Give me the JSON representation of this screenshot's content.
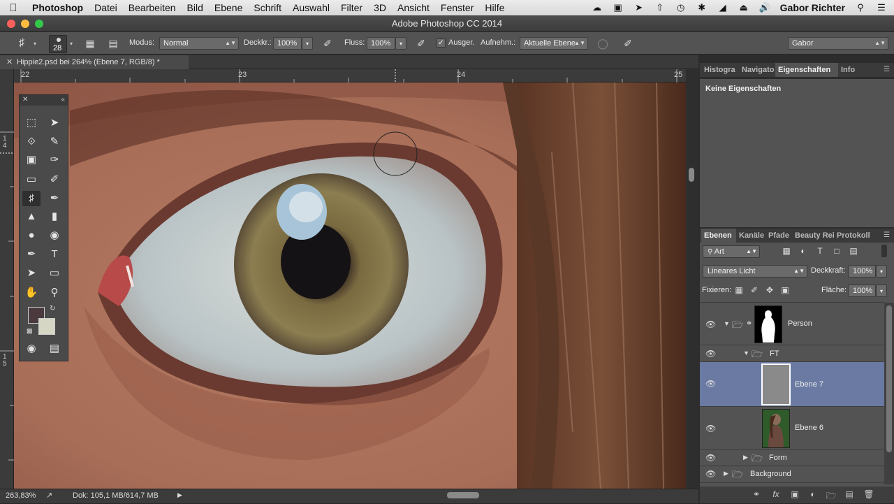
{
  "menubar": {
    "app": "Photoshop",
    "items": [
      "Datei",
      "Bearbeiten",
      "Bild",
      "Ebene",
      "Schrift",
      "Auswahl",
      "Filter",
      "3D",
      "Ansicht",
      "Fenster",
      "Hilfe"
    ],
    "user": "Gabor Richter"
  },
  "window": {
    "title": "Adobe Photoshop CC 2014"
  },
  "options": {
    "brush_size": "28",
    "mode_label": "Modus:",
    "mode_value": "Normal",
    "opacity_label": "Deckkr.:",
    "opacity_value": "100%",
    "flow_label": "Fluss:",
    "flow_value": "100%",
    "aligned_label": "Ausger.",
    "sample_label": "Aufnehm.:",
    "sample_value": "Aktuelle Ebene",
    "workspace_value": "Gabor"
  },
  "document": {
    "tab_title": "Hippie2.psd bei 264% (Ebene 7, RGB/8) *",
    "ruler_h": [
      "22",
      "23",
      "24",
      "25"
    ],
    "ruler_v": [
      "1\n4",
      "1\n5"
    ]
  },
  "status": {
    "zoom": "263,83%",
    "doc_info": "Dok: 105,1 MB/614,7 MB"
  },
  "panels": {
    "top_tabs": [
      "Histogra",
      "Navigato",
      "Eigenschaften",
      "Info"
    ],
    "properties_text": "Keine Eigenschaften",
    "layer_tabs": [
      "Ebenen",
      "Kanäle",
      "Pfade",
      "Beauty Rei",
      "Protokoll"
    ],
    "filter_kind": "Art",
    "blend_mode": "Lineares Licht",
    "opacity_label": "Deckkraft:",
    "opacity_value": "100%",
    "lock_label": "Fixieren:",
    "fill_label": "Fläche:",
    "fill_value": "100%"
  },
  "layers": [
    {
      "name": "Person",
      "type": "group-masked",
      "selected": false
    },
    {
      "name": "FT",
      "type": "group",
      "selected": false
    },
    {
      "name": "Ebene 7",
      "type": "layer-gray",
      "selected": true
    },
    {
      "name": "Ebene 6",
      "type": "layer-photo",
      "selected": false
    },
    {
      "name": "Form",
      "type": "group-collapsed",
      "selected": false
    },
    {
      "name": "Background",
      "type": "group-collapsed",
      "selected": false
    }
  ],
  "colors": {
    "foreground": "#4a3a3e",
    "background": "#d6d6c4",
    "selection": "#6a7aa3"
  }
}
